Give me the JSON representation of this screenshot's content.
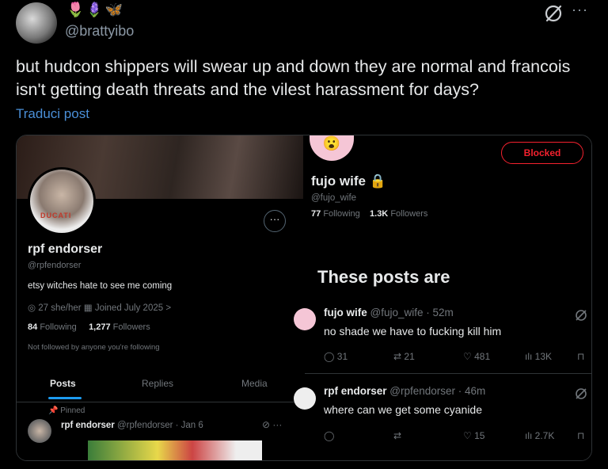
{
  "tweet": {
    "emojis": "🌷🪻🦋",
    "handle": "@brattyibo",
    "more": "···",
    "text": "but hudcon shippers will swear up and down they are normal and francois isn't getting death threats and the vilest harassment for days?",
    "translate": "Traduci post"
  },
  "left_profile": {
    "pfp_text": "DUCATI",
    "more": "···",
    "name": "rpf endorser",
    "handle": "@rpfendorser",
    "bio": "etsy witches hate to see me coming",
    "meta": "◎ 27 she/her   ▦ Joined July 2025 >",
    "following_count": "84",
    "following_label": "Following",
    "followers_count": "1,277",
    "followers_label": "Followers",
    "not_followed": "Not followed by anyone you're following",
    "tabs": [
      "Posts",
      "Replies",
      "Media"
    ],
    "pinned": "📌 Pinned",
    "post_name": "rpf endorser",
    "post_meta": "@rpfendorser · Jan 6",
    "post_icons": "⊘  ···"
  },
  "right_profile": {
    "avatar_emoji": "😮",
    "blocked": "Blocked",
    "name": "fujo wife 🔒",
    "handle": "@fujo_wife",
    "following_count": "77",
    "following_label": "Following",
    "followers_count": "1.3K",
    "followers_label": "Followers",
    "big_text": "These posts are",
    "posts": [
      {
        "name": "fujo wife",
        "meta": "@fujo_wife · 52m",
        "body": "no shade we have to fucking kill him",
        "replies": "31",
        "reposts": "21",
        "likes": "481",
        "views": "13K"
      },
      {
        "name": "rpf endorser",
        "meta": "@rpfendorser · 46m",
        "body": "where can we get some cyanide",
        "replies": "",
        "reposts": "",
        "likes": "15",
        "views": "2.7K"
      }
    ]
  },
  "colors": {
    "accent": "#1d9bf0",
    "blocked": "#f4212e",
    "link": "#4a8fd7"
  }
}
